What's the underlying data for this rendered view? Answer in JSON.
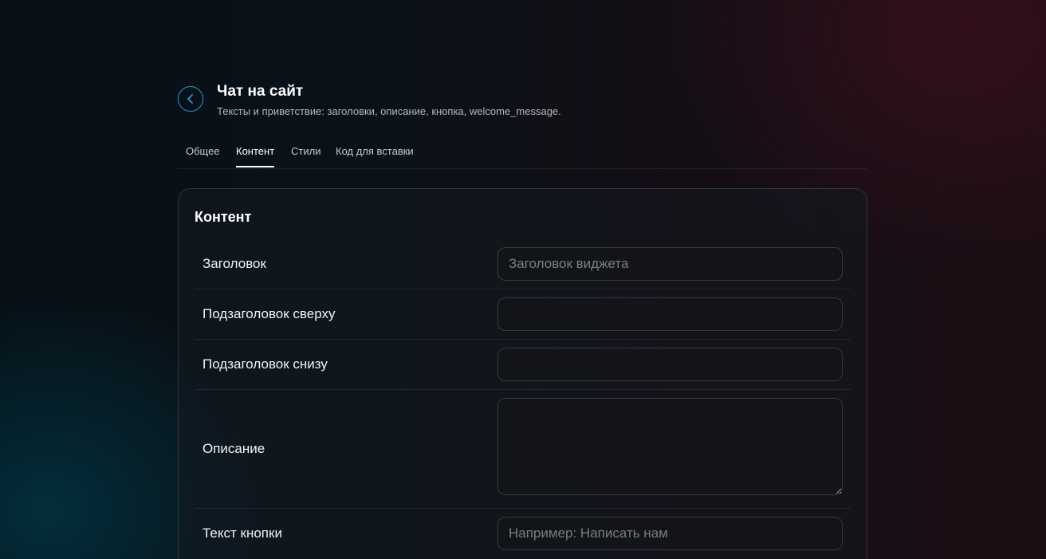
{
  "header": {
    "title": "Чат на сайт",
    "subtitle": "Тексты и приветствие: заголовки, описание, кнопка, welcome_message."
  },
  "tabs": [
    {
      "label": "Общее"
    },
    {
      "label": "Контент"
    },
    {
      "label": "Стили"
    },
    {
      "label": "Код для вставки"
    }
  ],
  "active_tab": "Контент",
  "card": {
    "title": "Контент",
    "fields": {
      "title": {
        "label": "Заголовок",
        "value": "",
        "placeholder": "Заголовок виджета"
      },
      "subtitle_top": {
        "label": "Подзаголовок сверху",
        "value": "",
        "placeholder": ""
      },
      "subtitle_bottom": {
        "label": "Подзаголовок снизу",
        "value": "",
        "placeholder": ""
      },
      "description": {
        "label": "Описание",
        "value": "",
        "placeholder": ""
      },
      "button_text": {
        "label": "Текст кнопки",
        "value": "",
        "placeholder": "Например: Написать нам"
      }
    }
  },
  "colors": {
    "accent": "#1d9bd1"
  },
  "icons": {
    "back": "chevron-left-icon"
  }
}
